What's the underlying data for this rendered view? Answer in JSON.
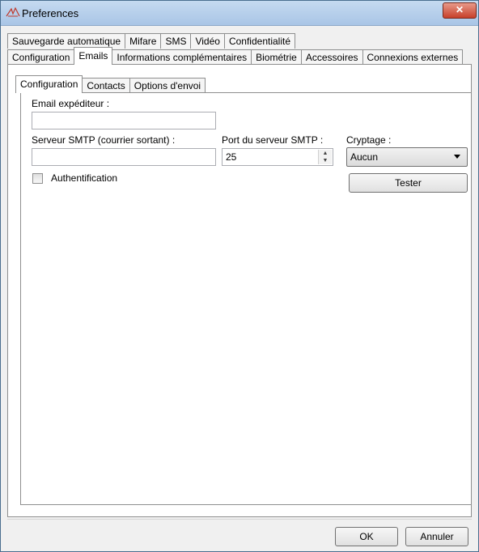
{
  "window": {
    "title": "Preferences",
    "app_icon": "preferences-app-icon",
    "close_label": "✕"
  },
  "tabs_row1": [
    "Sauvegarde automatique",
    "Mifare",
    "SMS",
    "Vidéo",
    "Confidentialité"
  ],
  "tabs_row2": [
    "Configuration",
    "Emails",
    "Informations complémentaires",
    "Biométrie",
    "Accessoires",
    "Connexions externes"
  ],
  "active_outer_tab": "Emails",
  "inner_tabs": [
    "Configuration",
    "Contacts",
    "Options d'envoi"
  ],
  "active_inner_tab": "Configuration",
  "form": {
    "sender_label": "Email expéditeur :",
    "sender_value": "",
    "smtp_server_label": "Serveur SMTP (courrier sortant) :",
    "smtp_server_value": "",
    "smtp_port_label": "Port du serveur SMTP :",
    "smtp_port_value": "25",
    "encryption_label": "Cryptage :",
    "encryption_value": "Aucun",
    "test_button": "Tester",
    "auth_label": "Authentification",
    "auth_checked": false
  },
  "footer": {
    "ok": "OK",
    "cancel": "Annuler"
  }
}
